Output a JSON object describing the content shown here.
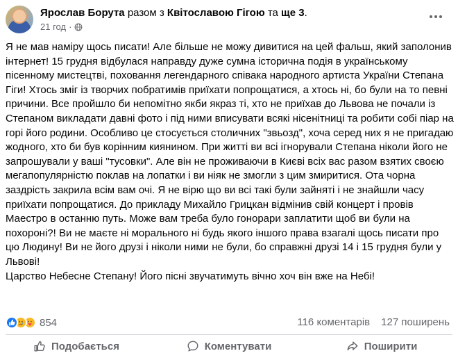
{
  "post": {
    "author": "Ярослав Борута",
    "with_word": "разом з",
    "tagged": "Квітославою Гігою",
    "and_word": "та",
    "others": "ще 3",
    "period": ".",
    "time": "21 год",
    "separator": "·",
    "privacy_icon": "globe-icon",
    "more_icon": "more-options-icon",
    "paragraphs": [
      "Я не мав наміру щось писати! Але більше не можу дивитися на цей фальш, який заполонив інтернет! 15 грудня відбулася направду дуже сумна історична подія в українському пісенному мистецтві, поховання легендарного співака народного артиста України Степана Гіги! Хтось зміг із творчих побратимів приїхати попрощатися, а хтось ні, бо були на то певні причини. Все пройшло би непомітно якби якраз ті, хто не приїхав до Львова не почали із Степаном викладати давні фото і під ними вписувати всякі нісенітниці та робити собі піар на горі його родини. Особливо це стосується столичних \"звьозд\", хоча серед них я не пригадаю жодного, хто би був корінним киянином. При житті ви всі ігнорували Степана ніколи його не запрошували у ваші \"тусовки\". Але він не проживаючи в Києві всіх вас разом взятих своєю мегапопулярністю поклав на лопатки і ви ніяк не змогли з цим змиритися. Ота чорна заздрість закрила всім вам очі. Я не вірю що ви всі такі були зайняті і не знайшли часу приїхати попрощатися. До прикладу Михайло Грицкан відмінив свій концерт і провів Маестро в останню путь. Може вам треба було гонорари заплатити щоб ви були на похороні?! Ви не маєте ні морального ні будь якого іншого права взагалі щось писати про цю Людину! Ви не його друзі і ніколи ними не були, бо справжні друзі 14 і 15 грудня були у Львові!",
      "Царство Небесне Степану! Його пісні звучатимуть вічно хоч він вже на Небі!"
    ]
  },
  "stats": {
    "reaction_icons": [
      "like-icon",
      "sad-icon",
      "care-icon"
    ],
    "reaction_count": "854",
    "comments": "116 коментарів",
    "shares": "127 поширень"
  },
  "actions": {
    "like": "Подобається",
    "comment": "Коментувати",
    "share": "Поширити"
  },
  "colors": {
    "accent": "#1877f2",
    "muted": "#65676b",
    "divider": "#ced0d4"
  }
}
